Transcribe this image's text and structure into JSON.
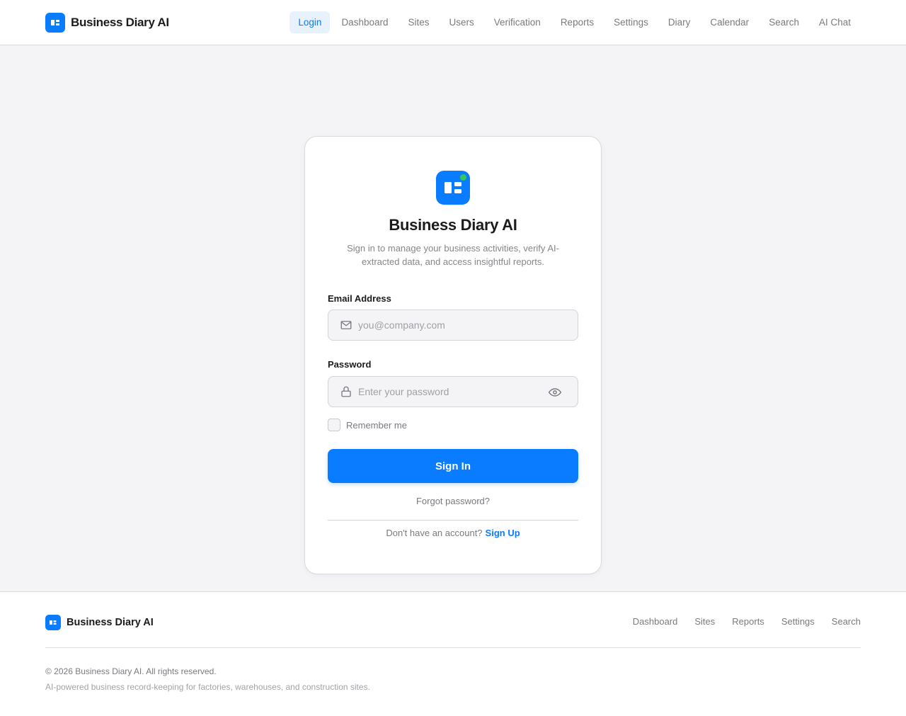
{
  "header": {
    "brand": "Business Diary AI",
    "nav": [
      {
        "label": "Login",
        "active": true
      },
      {
        "label": "Dashboard"
      },
      {
        "label": "Sites"
      },
      {
        "label": "Users"
      },
      {
        "label": "Verification"
      },
      {
        "label": "Reports"
      },
      {
        "label": "Settings"
      },
      {
        "label": "Diary"
      },
      {
        "label": "Calendar"
      },
      {
        "label": "Search"
      },
      {
        "label": "AI Chat"
      }
    ]
  },
  "login": {
    "title": "Business Diary AI",
    "subtitle": "Sign in to manage your business activities, verify AI-extracted data, and access insightful reports.",
    "email_label": "Email Address",
    "email_placeholder": "you@company.com",
    "email_icon": "mail-icon",
    "password_label": "Password",
    "password_placeholder": "Enter your password",
    "password_icon": "lock-icon",
    "toggle_icon": "eye-icon",
    "remember_label": "Remember me",
    "submit_label": "Sign In",
    "forgot_label": "Forgot password?",
    "no_account_text": "Don't have an account?",
    "signup_label": "Sign Up"
  },
  "footer": {
    "brand": "Business Diary AI",
    "links": [
      "Dashboard",
      "Sites",
      "Reports",
      "Settings",
      "Search"
    ],
    "copyright": "© 2026 Business Diary AI. All rights reserved.",
    "tagline": "AI-powered business record-keeping for factories, warehouses, and construction sites."
  },
  "colors": {
    "accent": "#0a7cff",
    "status_dot": "#34c759",
    "background": "#f4f4f6"
  }
}
